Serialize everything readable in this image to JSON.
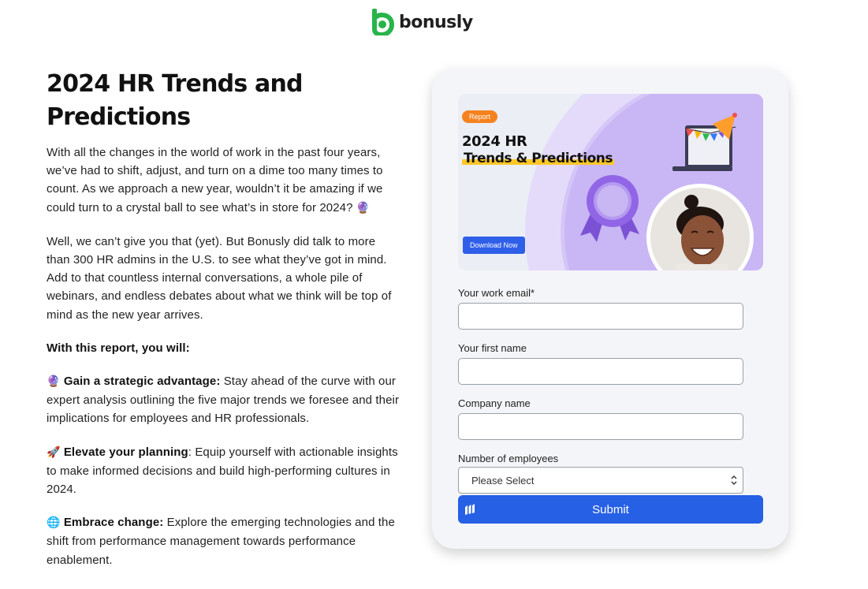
{
  "brand": {
    "name": "bonusly",
    "color": "#28b44a"
  },
  "page": {
    "title": "2024 HR Trends and Predictions",
    "intro1": "With all the changes in the world of work in the past four years, we’ve had to shift, adjust, and turn on a dime too many times to count. As we approach a new year, wouldn’t it be amazing if we could turn to a crystal ball to see what’s in store for 2024?",
    "intro2": "Well, we can’t give you that (yet). But Bonusly did talk to more than 300 HR admins in the U.S. to see what they’ve got in mind. Add to that countless internal conversations, a whole pile of webinars, and endless debates about what we think will be top of mind as the new year arrives.",
    "with_report": "With this report, you will:",
    "benefits": [
      {
        "icon": "crystal-ball",
        "title": "Gain a strategic advantage:",
        "text": " Stay ahead of the curve with our expert analysis outlining the five major trends we foresee and their implications for employees and HR professionals."
      },
      {
        "icon": "rocket",
        "title": "Elevate your planning",
        "text": ": Equip yourself with actionable insights to make informed decisions and build high-performing cultures in 2024."
      },
      {
        "icon": "globe",
        "title": "Embrace change:",
        "text": " Explore the emerging technologies and the shift from performance management towards performance enablement."
      }
    ]
  },
  "banner": {
    "badge": "Report",
    "title_line1": "2024 HR",
    "title_line2": "Trends & Predictions",
    "button": "Download Now",
    "accent": "#c9b6f5",
    "highlight": "#ffc728"
  },
  "form": {
    "email_label": "Your work email*",
    "first_name_label": "Your first name",
    "company_label": "Company name",
    "employees_label": "Number of employees",
    "employees_selected": "Please Select",
    "submit_label": "Submit",
    "submit_color": "#2660e4"
  }
}
